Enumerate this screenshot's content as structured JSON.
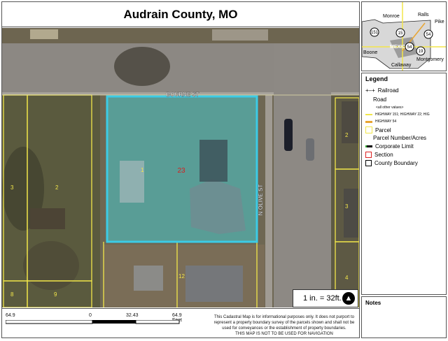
{
  "title": "Audrain County, MO",
  "map": {
    "street_bourne": "BOURNE ST",
    "street_olive": "N OLIVE ST",
    "parcel_label": "23",
    "parcel_numbers": [
      "1",
      "2",
      "3",
      "8",
      "9",
      "12",
      "2",
      "3",
      "4"
    ],
    "scale_text": "1 in. = 32ft.",
    "north_label": "N"
  },
  "inset": {
    "labels": [
      "Monroe",
      "Ralls",
      "Pike",
      "MEXICO",
      "Boone",
      "Callaway",
      "Montgomery"
    ],
    "routes": [
      "151",
      "15",
      "54",
      "54",
      "19"
    ]
  },
  "legend": {
    "title": "Legend",
    "items": [
      "Railroad",
      "Road",
      "<all other values>",
      "HIGHWAY 151; HIGHWAY 22; HIG",
      "HIGHWAY 54",
      "Parcel",
      "Parcel Number/Acres",
      "Corporate Limit",
      "Section",
      "County Boundary"
    ]
  },
  "notes": {
    "title": "Notes"
  },
  "footer": {
    "scalebar": [
      "64.9",
      "0",
      "32.43",
      "64.9 Feet"
    ],
    "disclaimer": "This Cadastral Map is for informational purposes only. It does not purport to represent a property boundary survey of the parcels shown and shall not be used for conveyances or the establishment of property boundaries.",
    "nav_warning": "THIS MAP IS NOT TO BE USED FOR NAVIGATION"
  },
  "colors": {
    "parcel_line": "#f2e64a",
    "selected_parcel": "#3ccbe6",
    "road": "#8f8b85",
    "grass": "#6b6450"
  }
}
